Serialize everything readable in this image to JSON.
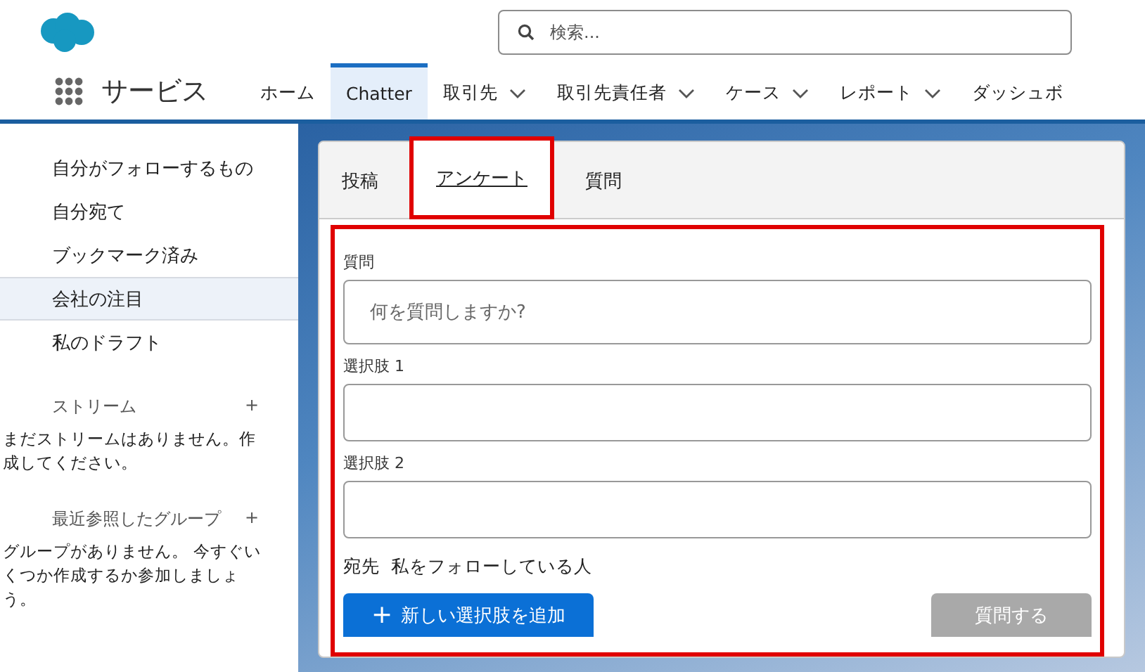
{
  "header": {
    "search": {
      "placeholder": "検索..."
    }
  },
  "nav": {
    "app_name": "サービス",
    "items": [
      {
        "label": "ホーム",
        "selected": false,
        "dropdown": false
      },
      {
        "label": "Chatter",
        "selected": true,
        "dropdown": false
      },
      {
        "label": "取引先",
        "selected": false,
        "dropdown": true
      },
      {
        "label": "取引先責任者",
        "selected": false,
        "dropdown": true
      },
      {
        "label": "ケース",
        "selected": false,
        "dropdown": true
      },
      {
        "label": "レポート",
        "selected": false,
        "dropdown": true
      },
      {
        "label": "ダッシュボ",
        "selected": false,
        "dropdown": false
      }
    ]
  },
  "sidebar": {
    "items": [
      {
        "label": "自分がフォローするもの",
        "selected": false
      },
      {
        "label": "自分宛て",
        "selected": false
      },
      {
        "label": "ブックマーク済み",
        "selected": false
      },
      {
        "label": "会社の注目",
        "selected": true
      },
      {
        "label": "私のドラフト",
        "selected": false
      }
    ],
    "sections": [
      {
        "title": "ストリーム",
        "add": "+",
        "message": "まだストリームはありません。作成してください。"
      },
      {
        "title": "最近参照したグループ",
        "add": "+",
        "message": "グループがありません。 今すぐいくつか作成するか参加しましょう。"
      }
    ]
  },
  "publisher": {
    "tabs": [
      {
        "label": "投稿",
        "selected": false,
        "highlighted": false
      },
      {
        "label": "アンケート",
        "selected": true,
        "highlighted": true
      },
      {
        "label": "質問",
        "selected": false,
        "highlighted": false
      }
    ],
    "form_highlighted": true,
    "fields": [
      {
        "label": "質問",
        "placeholder": "何を質問しますか?"
      },
      {
        "label": "選択肢 1"
      },
      {
        "label": "選択肢 2"
      }
    ],
    "audience_label": "宛先",
    "audience": "私をフォローしている人",
    "add_choice": {
      "icon": "+",
      "label": "新しい選択肢を追加"
    },
    "submit": {
      "label": "質問する",
      "disabled": true
    }
  }
}
